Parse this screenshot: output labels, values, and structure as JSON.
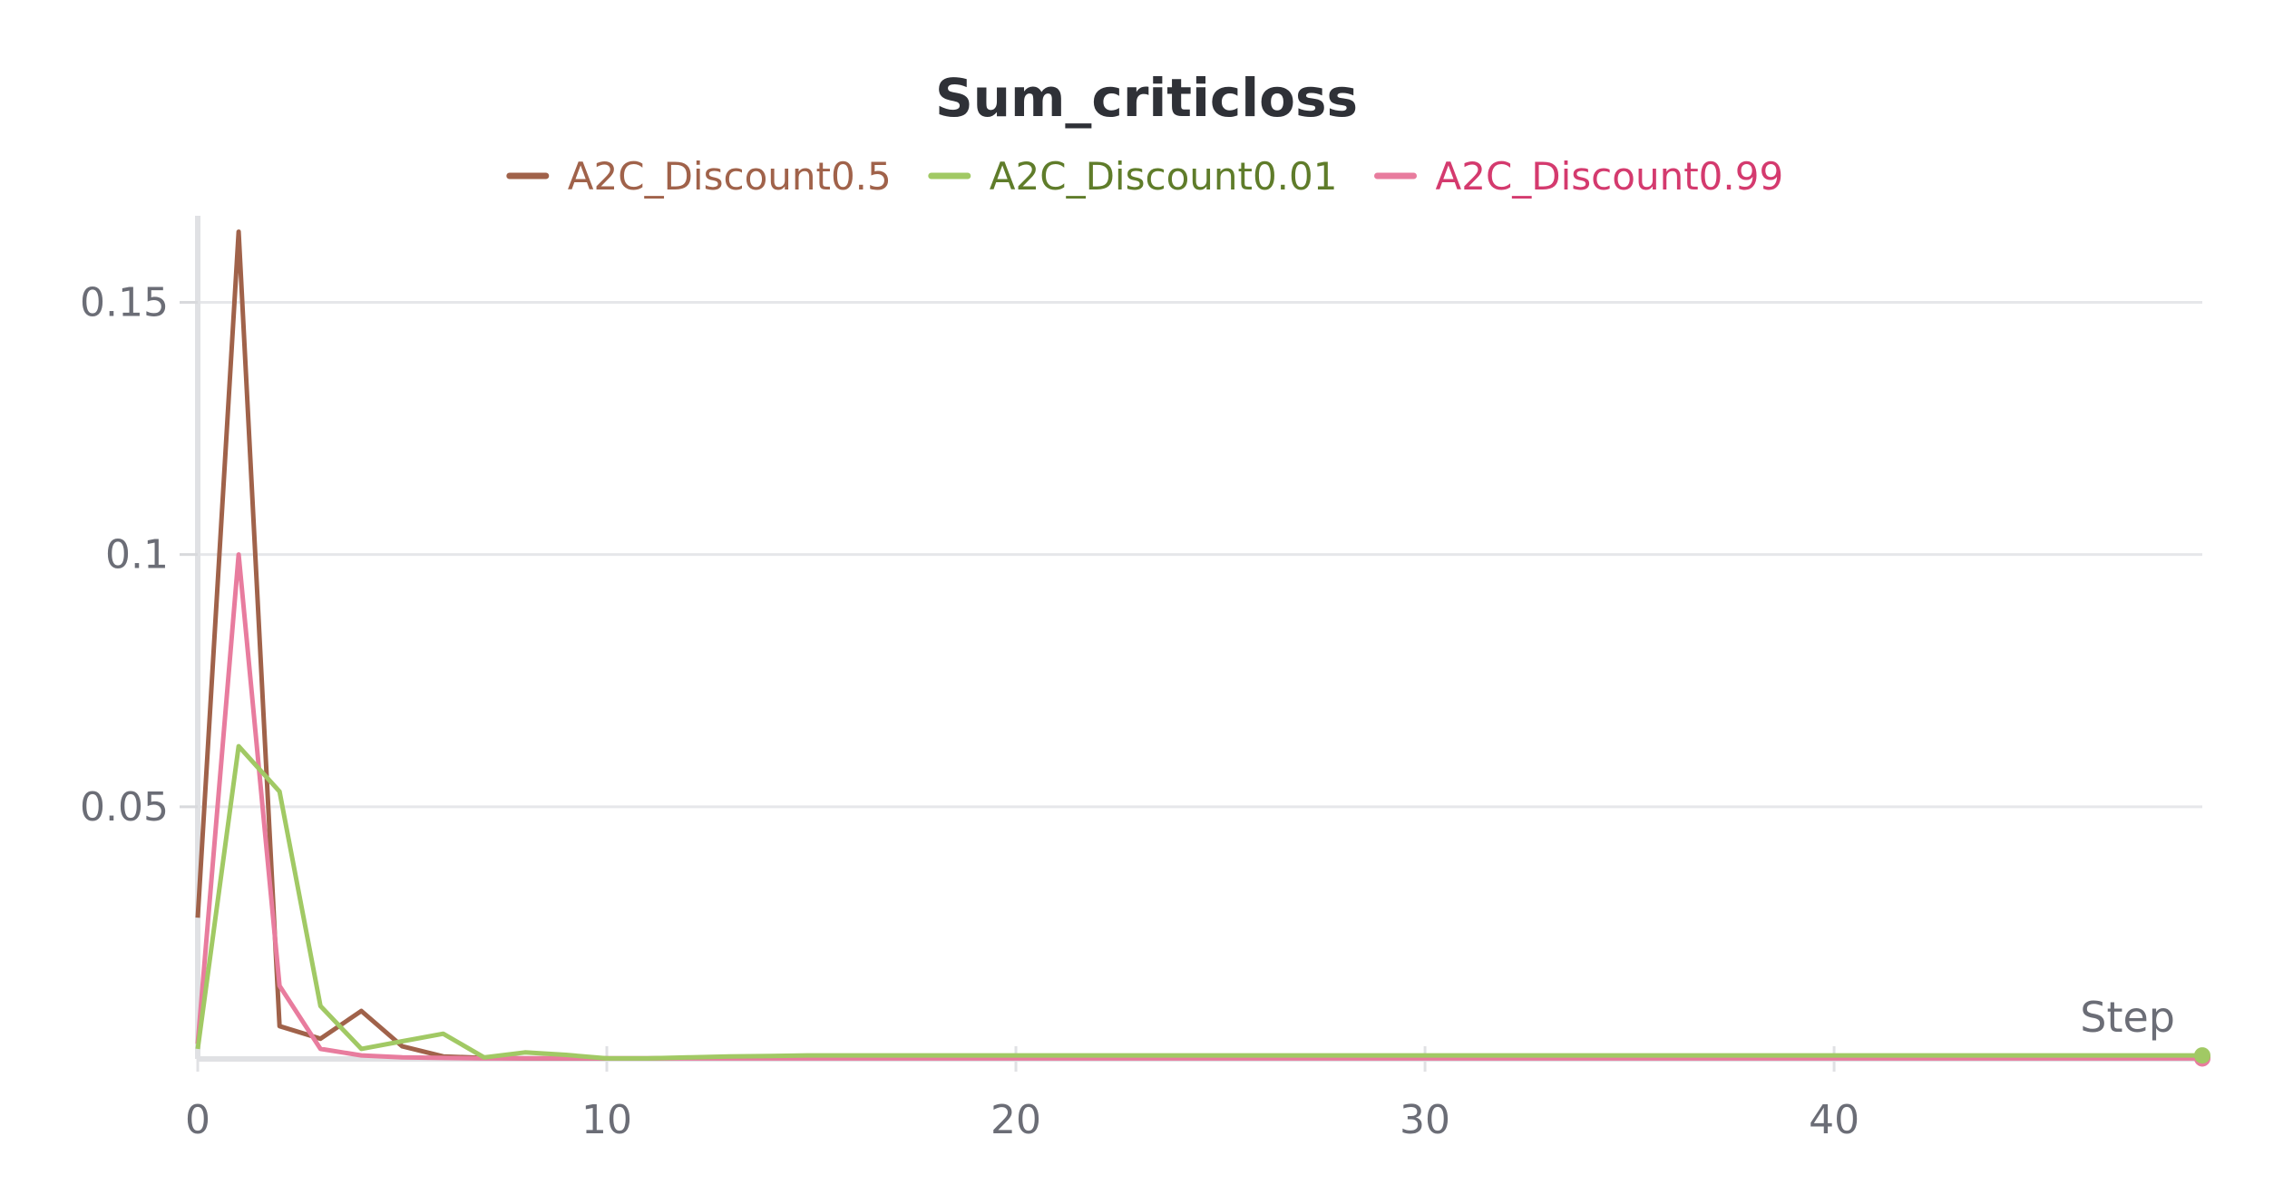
{
  "chart_data": {
    "type": "line",
    "title": "Sum_criticloss",
    "xlabel": "Step",
    "ylabel": "",
    "xlim": [
      0,
      49
    ],
    "ylim": [
      0,
      0.165
    ],
    "x_ticks": [
      {
        "value": 0,
        "label": "0"
      },
      {
        "value": 10,
        "label": "10"
      },
      {
        "value": 20,
        "label": "20"
      },
      {
        "value": 30,
        "label": "30"
      },
      {
        "value": 40,
        "label": "40"
      }
    ],
    "y_ticks": [
      {
        "value": 0.05,
        "label": "0.05"
      },
      {
        "value": 0.1,
        "label": "0.1"
      },
      {
        "value": 0.15,
        "label": "0.15"
      }
    ],
    "grid": true,
    "legend_position": "top-center",
    "x": [
      0,
      1,
      2,
      3,
      4,
      5,
      6,
      7,
      8,
      9,
      10,
      11,
      12,
      13,
      14,
      15,
      16,
      17,
      18,
      19,
      20,
      21,
      22,
      23,
      24,
      25,
      26,
      27,
      28,
      29,
      30,
      31,
      32,
      33,
      34,
      35,
      36,
      37,
      38,
      39,
      40,
      41,
      42,
      43,
      44,
      45,
      46,
      47,
      48,
      49
    ],
    "series": [
      {
        "name": "A2C_Discount0.5",
        "color": "#a0624a",
        "label_color": "#a0624a",
        "values": [
          0.028,
          0.164,
          0.0065,
          0.004,
          0.0095,
          0.0025,
          0.0005,
          0.0002,
          0.0001,
          0.0001,
          0.0001,
          0.0001,
          0.0002,
          0.0003,
          0.0003,
          0.0003,
          0.0003,
          0.0003,
          0.0003,
          0.0003,
          0.0003,
          0.0003,
          0.0003,
          0.0003,
          0.0003,
          0.0003,
          0.0003,
          0.0003,
          0.0003,
          0.0003,
          0.0003,
          0.0003,
          0.0003,
          0.0003,
          0.0003,
          0.0003,
          0.0003,
          0.0003,
          0.0003,
          0.0003,
          0.0003,
          0.0003,
          0.0003,
          0.0003,
          0.0003,
          0.0003,
          0.0003,
          0.0003,
          0.0003,
          0.0003
        ]
      },
      {
        "name": "A2C_Discount0.01",
        "color": "#a1c964",
        "label_color": "#5f7c2a",
        "values": [
          0.002,
          0.062,
          0.053,
          0.0105,
          0.002,
          0.0035,
          0.005,
          0.0003,
          0.0013,
          0.0008,
          0.0001,
          0.0001,
          0.0003,
          0.0005,
          0.0006,
          0.0007,
          0.0007,
          0.0007,
          0.0007,
          0.0007,
          0.0007,
          0.0007,
          0.0007,
          0.0007,
          0.0007,
          0.0007,
          0.0007,
          0.0007,
          0.0007,
          0.0007,
          0.0007,
          0.0007,
          0.0007,
          0.0007,
          0.0007,
          0.0007,
          0.0007,
          0.0007,
          0.0007,
          0.0007,
          0.0007,
          0.0007,
          0.0007,
          0.0007,
          0.0007,
          0.0007,
          0.0007,
          0.0007,
          0.0007,
          0.0007
        ]
      },
      {
        "name": "A2C_Discount0.99",
        "color": "#e87c9e",
        "label_color": "#d43a6e",
        "values": [
          0.003,
          0.1,
          0.0145,
          0.002,
          0.0007,
          0.0003,
          0.0002,
          0.0001,
          0.0001,
          0.0001,
          0.0001,
          0.0001,
          0.0001,
          0.0001,
          0.0001,
          0.0001,
          0.0001,
          0.0001,
          0.0001,
          0.0001,
          0.0001,
          0.0001,
          0.0001,
          0.0001,
          0.0001,
          0.0001,
          0.0001,
          0.0001,
          0.0001,
          0.0001,
          0.0001,
          0.0001,
          0.0001,
          0.0001,
          0.0001,
          0.0001,
          0.0001,
          0.0001,
          0.0001,
          0.0001,
          0.0001,
          0.0001,
          0.0001,
          0.0001,
          0.0001,
          0.0001,
          0.0001,
          0.0001,
          0.0001,
          0.0001
        ]
      }
    ]
  }
}
